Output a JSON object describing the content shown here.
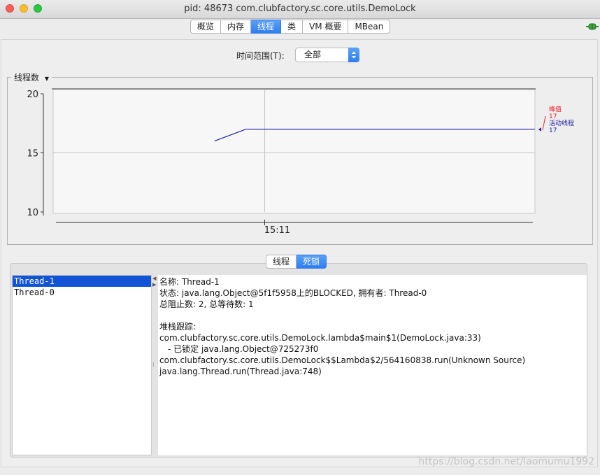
{
  "window": {
    "title": "pid: 48673 com.clubfactory.sc.core.utils.DemoLock"
  },
  "tabs": [
    {
      "label": "概览",
      "active": false
    },
    {
      "label": "内存",
      "active": false
    },
    {
      "label": "线程",
      "active": true
    },
    {
      "label": "类",
      "active": false
    },
    {
      "label": "VM 概要",
      "active": false
    },
    {
      "label": "MBean",
      "active": false
    }
  ],
  "time_range": {
    "label": "时间范围(T):",
    "selected": "全部"
  },
  "chart": {
    "section_label": "线程数",
    "chart_data": {
      "type": "line",
      "title": "",
      "xlabel": "",
      "ylabel": "",
      "ylim": [
        10,
        20
      ],
      "yticks": [
        10,
        15,
        20
      ],
      "xticks": [
        "15:11"
      ],
      "grid": true,
      "legend_position": "right",
      "series": [
        {
          "name": "峰值",
          "color": "#e8222a",
          "current": 17,
          "x": [
            0.335,
            0.4,
            1.0
          ],
          "values": [
            16,
            17,
            17
          ]
        },
        {
          "name": "活动线程",
          "color": "#1c1ca0",
          "current": 17,
          "x": [
            0.335,
            0.4,
            1.0
          ],
          "values": [
            16,
            17,
            17
          ]
        }
      ]
    }
  },
  "subtabs": [
    {
      "label": "线程",
      "active": false
    },
    {
      "label": "死锁",
      "active": true
    }
  ],
  "threads": [
    {
      "name": "Thread-1",
      "selected": true
    },
    {
      "name": "Thread-0",
      "selected": false
    }
  ],
  "details": [
    "名称: Thread-1",
    "状态: java.lang.Object@5f1f5958上的BLOCKED, 拥有者: Thread-0",
    "总阻止数: 2, 总等待数: 1",
    "",
    "堆栈跟踪:",
    "com.clubfactory.sc.core.utils.DemoLock.lambda$main$1(DemoLock.java:33)",
    "- 已锁定 java.lang.Object@725273f0",
    "com.clubfactory.sc.core.utils.DemoLock$$Lambda$2/564160838.run(Unknown Source)",
    "java.lang.Thread.run(Thread.java:748)"
  ],
  "watermark": "https://blog.csdn.net/laomumu1992"
}
